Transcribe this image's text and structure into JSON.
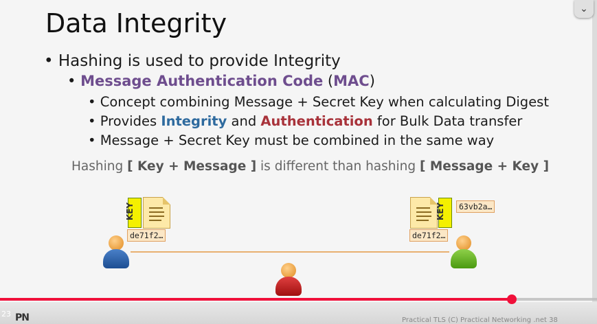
{
  "slide": {
    "title": "Data Integrity",
    "bullet1": "Hashing is used to provide Integrity",
    "bullet2": {
      "mac_label": "Message Authentication Code",
      "open": " (",
      "mac_abbr": "MAC",
      "close": ")"
    },
    "sub1": "Concept combining Message + Secret Key when calculating Digest",
    "sub2": {
      "pre": "Provides ",
      "integrity": "Integrity",
      "mid": " and ",
      "authentication": "Authentication",
      "post": " for Bulk Data transfer"
    },
    "sub3": "Message + Secret Key must be combined in the same way",
    "note": {
      "pre": "Hashing ",
      "b1": "[ Key + Message ]",
      "mid": " is different than hashing ",
      "b2": "[ Message + Key ]"
    },
    "left_key_label": "KEY",
    "right_key_label": "KEY",
    "left_digest": "de71f2…",
    "right_digest": "de71f2…",
    "right_extra_digest": "63vb2a…",
    "footer_text": "Practical TLS    (C) Practical Networking .net        38"
  },
  "player": {
    "time_label": "23",
    "logo_text": "PN",
    "menu_icon": "chevron-down-icon",
    "progress_percent": 85.7
  },
  "colors": {
    "purple": "#6e4d8e",
    "blue": "#2e6a9e",
    "red": "#a8323a",
    "progress": "#f0103a"
  }
}
